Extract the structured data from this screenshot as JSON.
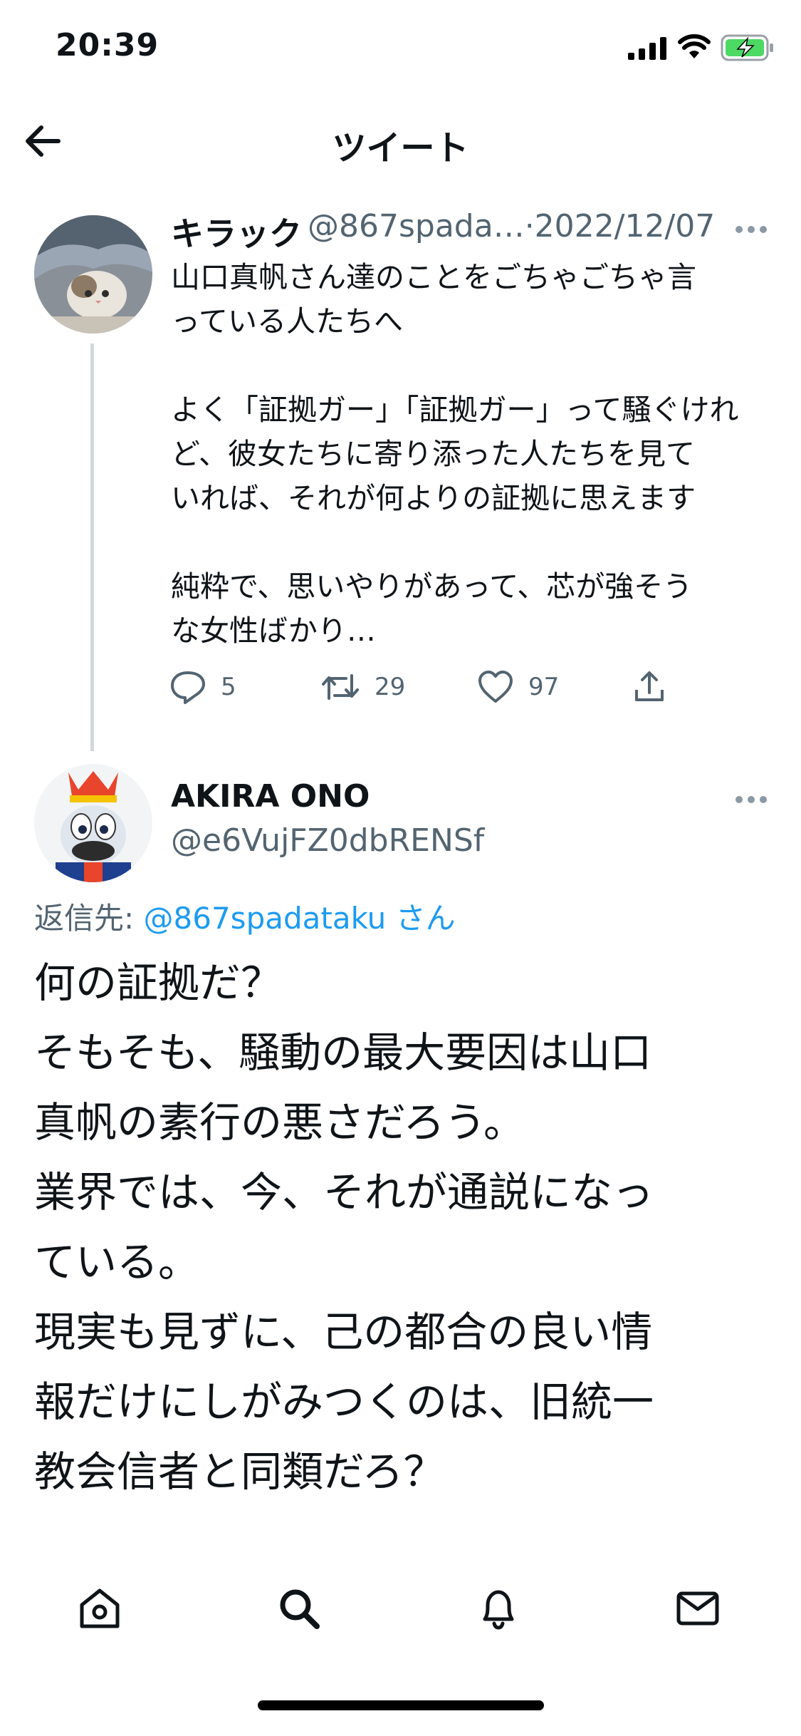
{
  "status_bar": {
    "time": "20:39",
    "icons": [
      "signal-icon",
      "wifi-icon",
      "battery-charging-icon"
    ],
    "battery_color": "#4cd964"
  },
  "header": {
    "title": "ツイート",
    "back_icon": "arrow-left-icon"
  },
  "tweets": [
    {
      "display_name": "キラック",
      "handle_date": "@867spada…·2022/12/07",
      "text": "山口真帆さん達のことをごちゃごちゃ言\nっている人たちへ\n\nよく「証拠ガー」「証拠ガー」って騒ぐけれ\nど、彼女たちに寄り添った人たちを見て\nいれば、それが何よりの証拠に思えます\n\n純粋で、思いやりがあって、芯が強そう\nな女性ばかり…",
      "actions": {
        "replies": "5",
        "retweets": "29",
        "likes": "97"
      }
    },
    {
      "display_name": "AKIRA ONO",
      "handle": "@e6VujFZ0dbRENSf",
      "reply_prefix": "返信先: ",
      "reply_to": "@867spadataku",
      "reply_suffix": " さん",
      "text": "何の証拠だ？\nそもそも、騒動の最大要因は山口\n真帆の素行の悪さだろう。\n業界では、今、それが通説になっ\nている。\n現実も見ずに、己の都合の良い情\n報だけにしがみつくのは、旧統一\n教会信者と同類だろ？"
    }
  ],
  "bottom_nav": {
    "items": [
      "home-icon",
      "search-icon",
      "bell-icon",
      "mail-icon"
    ]
  },
  "colors": {
    "link": "#1d9bf0",
    "secondary_text": "#536471",
    "thread_line": "#cfd9de"
  }
}
